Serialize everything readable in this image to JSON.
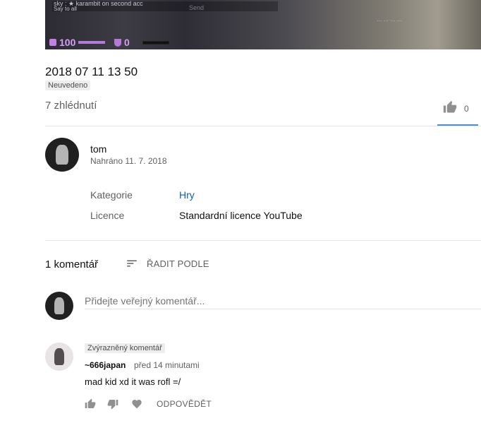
{
  "video": {
    "chat_line1": "sky :  ★ karambit on second acc",
    "chat_line2": "Say to all",
    "send_label": "Send",
    "hud_info": "... ... ... ...",
    "health": "100",
    "armor": "0"
  },
  "title": "2018 07 11 13 50",
  "visibility_badge": "Neuvedeno",
  "views": "7 zhlédnutí",
  "likes": "0",
  "channel": {
    "name": "tom",
    "upload_date": "Nahráno 11. 7. 2018"
  },
  "metadata": [
    {
      "label": "Kategorie",
      "value": "Hry"
    },
    {
      "label": "Licence",
      "value": "Standardní licence YouTube"
    }
  ],
  "comments": {
    "count_label": "1 komentář",
    "sort_label": "ŘADIT PODLE",
    "add_placeholder": "Přidejte veřejný komentář...",
    "items": [
      {
        "badge": "Zvýrazněný komentář",
        "author": "~666japan",
        "time": "před 14 minutami",
        "text": "mad kid xd it was rofl =/",
        "reply_label": "ODPOVĚDĚT"
      }
    ]
  },
  "colors": {
    "link": "#065fd4",
    "like_underline": "#4a90d9",
    "muted": "#606060"
  }
}
